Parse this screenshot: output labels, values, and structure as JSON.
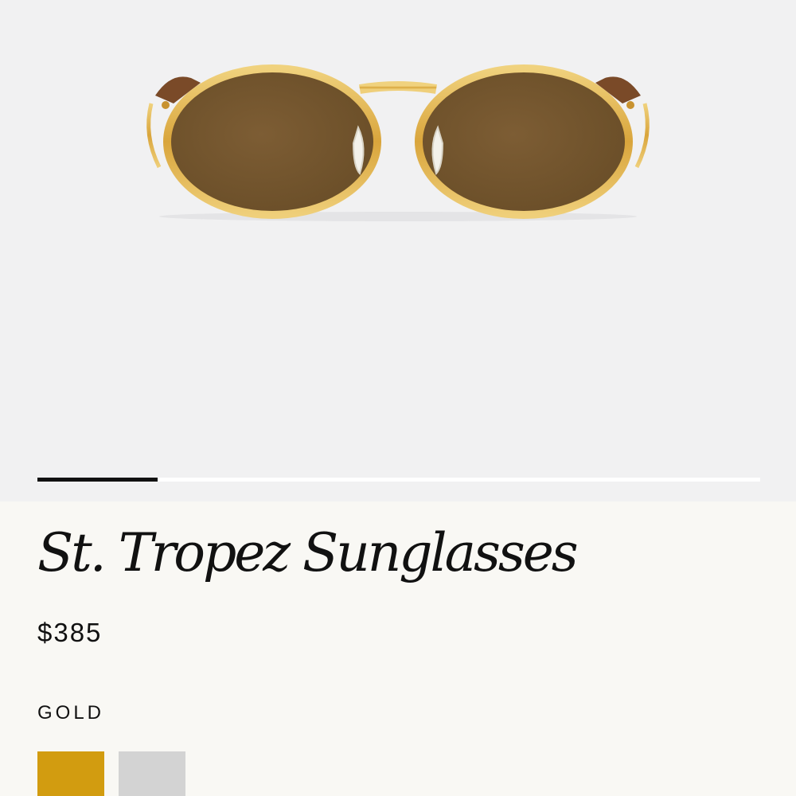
{
  "product": {
    "title": "St. Tropez Sunglasses",
    "price": "$385",
    "color_label": "GOLD",
    "image": {
      "subject": "gold oval sunglasses with brown lenses",
      "frame_color": "#e0b04a",
      "lens_color": "#70532b",
      "temple_color": "#6b4020"
    }
  },
  "gallery": {
    "progress_fraction": 0.166,
    "track_color": "#ffffff",
    "fill_color": "#111111"
  },
  "swatches": [
    {
      "name": "Gold",
      "color": "#d29c10",
      "selected": true
    },
    {
      "name": "Silver",
      "color": "#d3d3d3",
      "selected": false
    }
  ]
}
